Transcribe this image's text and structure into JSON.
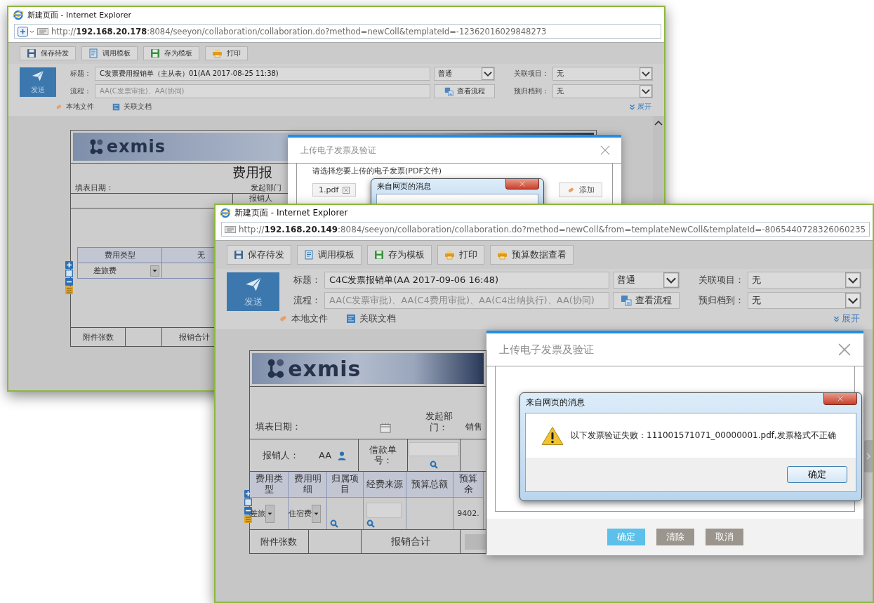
{
  "back_window": {
    "title": "新建页面 - Internet Explorer",
    "address": "http://**192.168.20.178**:8084/seeyon/collaboration/collaboration.do?method=newColl&templateId=-12362016029848273",
    "toolbar": [
      {
        "kind": "save",
        "label": "保存待发"
      },
      {
        "kind": "template",
        "label": "调用模板"
      },
      {
        "kind": "save-template",
        "label": "存为模板"
      },
      {
        "kind": "print",
        "label": "打印"
      }
    ],
    "send_button": "发送",
    "subject": {
      "label": "标题：",
      "value": "C发票费用报销单（主从表）01(AA 2017-08-25 11:38)"
    },
    "priority": "普通",
    "related_project": {
      "label": "关联项目：",
      "value": "无"
    },
    "flow": {
      "label": "流程：",
      "value": "AA(C发票审批)、AA(协同)"
    },
    "view_flow_button": "查看流程",
    "archive": {
      "label": "预归档到：",
      "value": "无"
    },
    "attachments": [
      {
        "kind": "local",
        "label": "本地文件"
      },
      {
        "kind": "linked",
        "label": "关联文档"
      }
    ],
    "expand_link": "展开",
    "form": {
      "logo": "exmis",
      "title": "费用报",
      "date_label": "填表日期：",
      "department_label": "发起部门",
      "claimant_label": "报销人",
      "detail_headers": [
        "费用类型",
        "无"
      ],
      "detail_row": [
        {
          "kind": "select",
          "value": "差旅费"
        },
        {
          "kind": "empty"
        }
      ],
      "attachment_count_label": "附件张数",
      "total_label": "报销合计"
    },
    "dialog": {
      "title": "上传电子发票及验证",
      "prompt": "请选择您要上传的电子发票(PDF文件)",
      "file": "1.pdf",
      "add_button": "添加",
      "message_box": {
        "title": "来自网页的消息"
      }
    }
  },
  "front_window": {
    "title": "新建页面 - Internet Explorer",
    "address": "http://**192.168.20.149**:8084/seeyon/collaboration/collaboration.do?method=newColl&from=templateNewColl&templateId=-8065440728326060235",
    "toolbar": [
      {
        "kind": "save",
        "label": "保存待发"
      },
      {
        "kind": "template",
        "label": "调用模板"
      },
      {
        "kind": "save-template",
        "label": "存为模板"
      },
      {
        "kind": "print",
        "label": "打印"
      },
      {
        "kind": "budget",
        "label": "预算数据查看"
      }
    ],
    "send_button": "发送",
    "subject": {
      "label": "标题：",
      "value": "C4C发票报销单(AA 2017-09-06 16:48)"
    },
    "priority": "普通",
    "related_project": {
      "label": "关联项目：",
      "value": "无"
    },
    "flow": {
      "label": "流程：",
      "value": "AA(C发票审批)、AA(C4费用审批)、AA(C4出纳执行)、AA(协同)"
    },
    "view_flow_button": "查看流程",
    "archive": {
      "label": "预归档到：",
      "value": "无"
    },
    "attachments": [
      {
        "kind": "local",
        "label": "本地文件"
      },
      {
        "kind": "linked",
        "label": "关联文档"
      }
    ],
    "expand_link": "展开",
    "form": {
      "logo": "exmis",
      "date_label": "填表日期：",
      "department_label": "发起部门：",
      "department_value": "销售",
      "claimant_label": "报销人：",
      "claimant_value": "AA",
      "loan_label": "借款单号：",
      "detail_headers": [
        "费用类型",
        "费用明细",
        "归属项目",
        "经费来源",
        "预算总额",
        "预算余"
      ],
      "detail_row": [
        {
          "kind": "select",
          "value": "差旅"
        },
        {
          "kind": "select",
          "value": "住宿费"
        },
        {
          "kind": "lookup"
        },
        {
          "kind": "lookup-input"
        },
        {
          "kind": "empty"
        },
        {
          "kind": "text",
          "value": "9402."
        }
      ],
      "attachment_count_label": "附件张数",
      "total_label": "报销合计"
    },
    "dialog": {
      "title": "上传电子发票及验证",
      "buttons": [
        {
          "kind": "primary",
          "label": "确定"
        },
        {
          "kind": "secondary",
          "label": "清除"
        },
        {
          "kind": "secondary",
          "label": "取消"
        }
      ],
      "message_box": {
        "title": "来自网页的消息",
        "message": "以下发票验证失败：111001571071_00000001.pdf,发票格式不正确",
        "ok_button": "确定"
      }
    }
  }
}
